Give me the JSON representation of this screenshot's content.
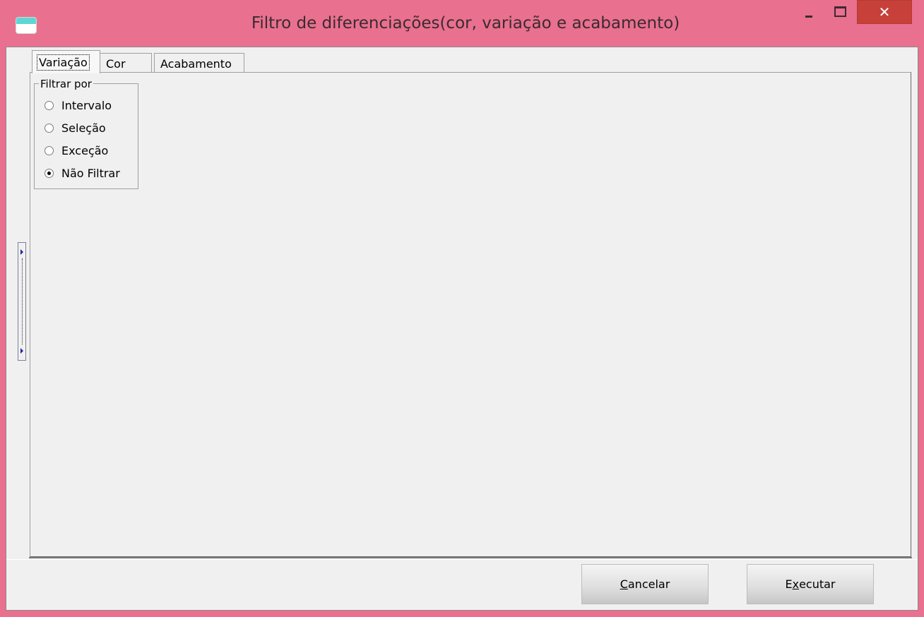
{
  "window": {
    "title": "Filtro de diferenciações(cor, variação e acabamento)",
    "close_glyph": "✕"
  },
  "tabs": [
    {
      "label": "Variação",
      "active": true
    },
    {
      "label": "Cor",
      "active": false
    },
    {
      "label": "Acabamento",
      "active": false
    }
  ],
  "filter_group": {
    "legend": "Filtrar por",
    "options": [
      {
        "label": "Intervalo",
        "selected": false
      },
      {
        "label": "Seleção",
        "selected": false
      },
      {
        "label": "Exceção",
        "selected": false
      },
      {
        "label": "Não Filtrar",
        "selected": true
      }
    ]
  },
  "buttons": {
    "cancel": {
      "mnemonic": "C",
      "rest": "ancelar"
    },
    "execute": {
      "pre": "E",
      "mnemonic": "x",
      "rest": "ecutar"
    }
  },
  "colors": {
    "titlebar": "#e9708f",
    "close_button": "#c7403a",
    "client_bg": "#f0f0f0"
  }
}
